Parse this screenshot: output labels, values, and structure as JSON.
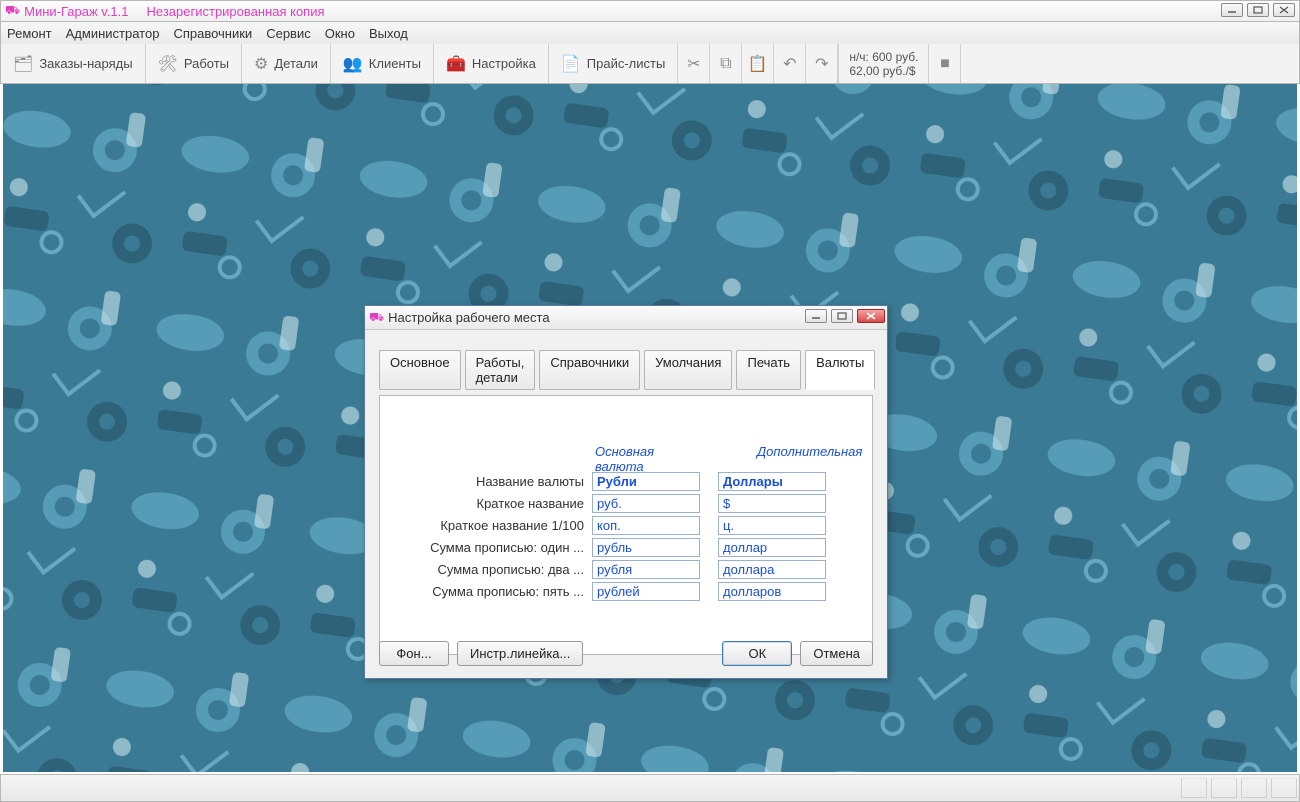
{
  "app": {
    "title": "Мини-Гараж v.1.1",
    "subtitle": "Незарегистрированная копия"
  },
  "menu": {
    "items": [
      "Ремонт",
      "Администратор",
      "Справочники",
      "Сервис",
      "Окно",
      "Выход"
    ]
  },
  "toolbar": {
    "orders": "Заказы-наряды",
    "jobs": "Работы",
    "parts": "Детали",
    "clients": "Клиенты",
    "settings": "Настройка",
    "pricelists": "Прайс-листы",
    "rate_line1": "н/ч: 600 руб.",
    "rate_line2": "62,00 руб./$"
  },
  "dialog": {
    "title": "Настройка рабочего места",
    "tabs": [
      "Основное",
      "Работы, детали",
      "Справочники",
      "Умолчания",
      "Печать",
      "Валюты"
    ],
    "active_tab": 5,
    "col_main": "Основная валюта",
    "col_extra": "Дополнительная",
    "rows": [
      {
        "label": "Название валюты",
        "main": "Рубли",
        "extra": "Доллары",
        "bold": true
      },
      {
        "label": "Краткое название",
        "main": "руб.",
        "extra": "$"
      },
      {
        "label": "Краткое название 1/100",
        "main": "коп.",
        "extra": "ц."
      },
      {
        "label": "Сумма прописью: один ...",
        "main": "рубль",
        "extra": "доллар"
      },
      {
        "label": "Сумма прописью: два ...",
        "main": "рубля",
        "extra": "доллара"
      },
      {
        "label": "Сумма прописью: пять ...",
        "main": "рублей",
        "extra": "долларов"
      }
    ],
    "btn_bg": "Фон...",
    "btn_ruler": "Инстр.линейка...",
    "btn_ok": "ОК",
    "btn_cancel": "Отмена"
  }
}
